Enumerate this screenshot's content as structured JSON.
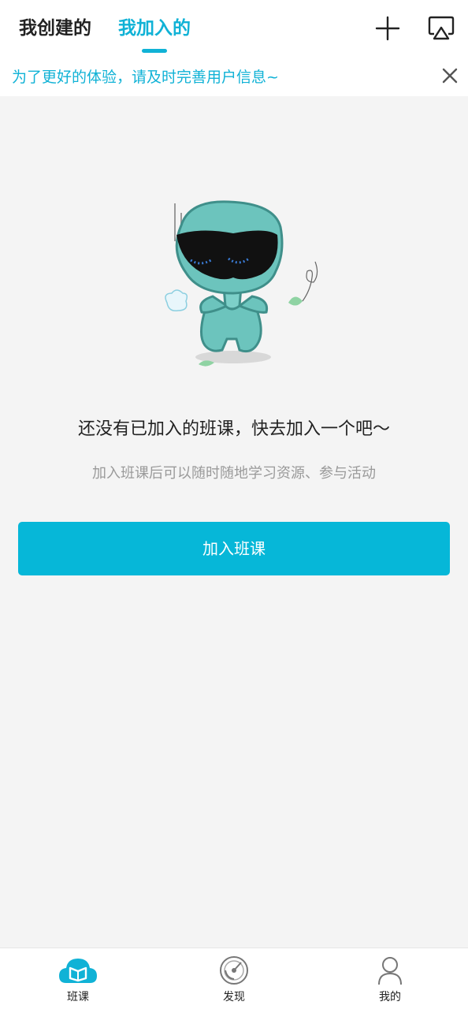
{
  "header": {
    "tabs": [
      {
        "label": "我创建的",
        "active": false
      },
      {
        "label": "我加入的",
        "active": true
      }
    ],
    "actions": [
      {
        "icon": "plus-icon"
      },
      {
        "icon": "screen-cast-icon"
      }
    ]
  },
  "notice": {
    "text": "为了更好的体验，请及时完善用户信息~",
    "close_icon": "close-icon"
  },
  "empty_state": {
    "illustration": "mascot-illustration",
    "title": "还没有已加入的班课，快去加入一个吧～",
    "subtitle": "加入班课后可以随时随地学习资源、参与活动",
    "button_label": "加入班课"
  },
  "bottom_nav": {
    "items": [
      {
        "label": "班课",
        "icon": "cloud-book-icon",
        "active": true
      },
      {
        "label": "发现",
        "icon": "compass-icon",
        "active": false
      },
      {
        "label": "我的",
        "icon": "person-icon",
        "active": false
      }
    ]
  },
  "colors": {
    "accent": "#10b2d6",
    "button": "#06b7d8",
    "background": "#f4f4f4"
  }
}
